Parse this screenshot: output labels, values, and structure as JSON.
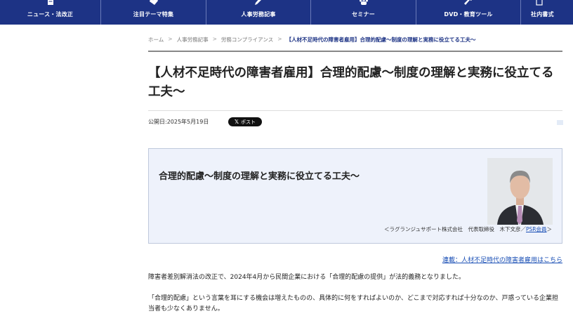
{
  "nav": {
    "items": [
      {
        "label": "ニュース・法改正",
        "icon": "document-icon"
      },
      {
        "label": "注目テーマ特集",
        "icon": "tag-icon"
      },
      {
        "label": "人事労務記事",
        "icon": "pen-icon"
      },
      {
        "label": "セミナー",
        "icon": "people-icon"
      },
      {
        "label": "DVD・教育ツール",
        "icon": "tool-icon"
      },
      {
        "label": "社内書式",
        "icon": "file-icon"
      }
    ],
    "bg_color": "#1d3385"
  },
  "breadcrumb": {
    "home": "ホーム",
    "level1": "人事労務記事",
    "level2": "労務コンプライアンス",
    "current": "【人材不足時代の障害者雇用】合理的配慮〜制度の理解と実務に役立てる工夫〜",
    "sep": ">"
  },
  "article": {
    "title": "【人材不足時代の障害者雇用】合理的配慮〜制度の理解と実務に役立てる工夫〜",
    "published": "公開日:2025年5月19日",
    "post_button": "ポスト",
    "post_icon": "x-logo-icon"
  },
  "lead": {
    "title": "合理的配慮〜制度の理解と実務に役立てる工夫〜",
    "author_prefix": "＜ラグランジュサポート株式会社　代表取締役　木下文彦／",
    "author_link": "PSR会員",
    "author_suffix": "＞"
  },
  "series_link": "連載：人材不足時代の障害者雇用はこちら",
  "body": {
    "p1": "障害者差別解消法の改正で、2024年4月から民間企業における「合理的配慮の提供」が法的義務となりました。",
    "p2": "「合理的配慮」という言葉を耳にする機会は増えたものの、具体的に何をすればよいのか、どこまで対応すれば十分なのか、戸惑っている企業担当者も少なくありません。"
  },
  "colors": {
    "accent": "#1d3385",
    "link": "#1a4fb5",
    "lead_bg": "#eef2fb"
  }
}
